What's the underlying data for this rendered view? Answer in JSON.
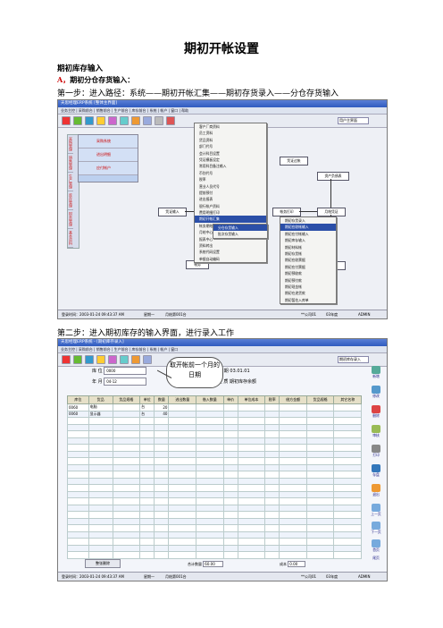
{
  "doc": {
    "title": "期初开帐设置",
    "section": "期初库存输入",
    "subsection_letter": "A，",
    "subsection": "期初分仓存货输入：",
    "step1": "第一步：进入路径：系统——期初开帐汇集——期初存货录入——分仓存货输入",
    "step2": "第二步：进入期初库存的输入界面，进行录入工作"
  },
  "shot1": {
    "window_title": "天思经理ERP系统 [整体主界面]",
    "menubar": "业务主控 | 采购前台 | 销售前台 | 生产前台 | 库存前台 | 系统 | 帐户 | 窗口 | 帮助",
    "toolbar_select": "用户主界面",
    "sidenav": [
      "采购管理",
      "销售管理",
      "生产管理",
      "库存管理",
      "财务管理",
      "基本资料"
    ],
    "modules": [
      "采购系统",
      "进出明细",
      "应付帐户"
    ],
    "menu1": [
      "客户厂商资料",
      "员工资料",
      "货品资料",
      "部门代号",
      "会计科目设置",
      "凭证模板设定",
      "常用科目备注输入",
      "币别代号",
      "税率",
      "营业人员代号",
      "提前预付",
      "进出报表",
      "银行帐户资料",
      "费用明细打印",
      "期初开帐汇集",
      "帐务期结",
      "月结中心",
      "报表中心",
      "资料转出",
      "系统代码设置",
      "单据自动编码"
    ],
    "menu2": [
      "分仓存货输入",
      "批次存货输入"
    ],
    "menu3": [
      "期初存货录入",
      "期初应收帐输入",
      "期初应付帐输入",
      "期初库存输入",
      "期初材料帐",
      "期初存货帐",
      "期初应收票据",
      "期初应付票据",
      "期初预收款",
      "期初预付款",
      "期初现金帐",
      "期初在途货款",
      "期初暂估入库单"
    ],
    "flow_boxes": [
      "凭证输入",
      "凭证过帐",
      "帐务打印",
      "资产负债表",
      "损益表",
      "月结凭证",
      "帐务",
      "财务报表"
    ],
    "status": {
      "time": "登录时间：2003-01-24 09:43:37 AM",
      "weekday": "星期一",
      "db": "月结第001台",
      "company": "**公司01",
      "year": "03年度",
      "user": "ADMIN"
    }
  },
  "shot2": {
    "window_title": "天思经理ERP系统 - [期初库存录入]",
    "menubar": "业务主控 | 采购前台 | 销售前台 | 生产前台 | 库存前台 | 系统 | 帐户 | 窗口",
    "toolbar_select": "期初库存录入",
    "form": {
      "warehouse_label": "库    位",
      "warehouse_value": "0000",
      "year_label": "年    月",
      "year_value": "04-12",
      "date_label": "日期",
      "date_value": "03.01.01",
      "type_label": "性    质",
      "type_value": "期初库存余额"
    },
    "callout": "取开帐前一个月的日期",
    "columns": [
      "库位",
      "货品",
      "货品规格",
      "单位",
      "数量",
      "进出数量",
      "借入数量",
      "单价",
      "单位成本",
      "税率",
      "借方金额",
      "货品规格",
      "其它名称"
    ],
    "rows": [
      [
        "0060",
        "电脑",
        "",
        "台",
        "20"
      ],
      [
        "0060",
        "显示器",
        "",
        "台",
        "40"
      ]
    ],
    "footer_button": "整张删除",
    "total_qty_label": "合计数量",
    "total_qty_value": "60.00",
    "total_cost_label": "成本",
    "total_cost_value": "0.00",
    "right_buttons": [
      "新增",
      "修改",
      "删除",
      "审核",
      "打印",
      "存盘",
      "退出",
      "上一页",
      "下一页",
      "首页",
      "尾页"
    ],
    "status": {
      "time": "登录时间：2003-01-24 09:43:37 AM",
      "weekday": "星期一",
      "db": "月结第001台",
      "company": "**公司01",
      "year": "03年度",
      "user": "ADMIN"
    }
  }
}
